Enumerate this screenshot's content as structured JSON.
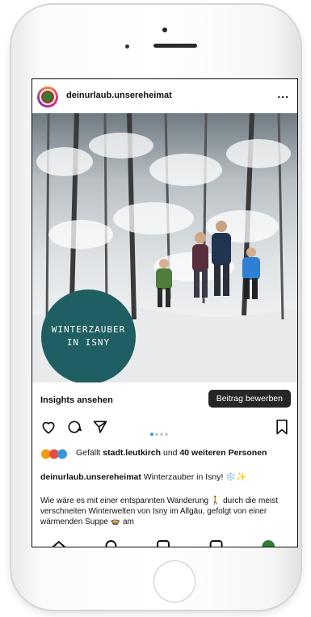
{
  "post": {
    "username": "deinurlaub.unsereheimat",
    "more": "...",
    "badge": {
      "line1": "WINTERZAUBER",
      "line2": "IN ISNY"
    },
    "insights": "Insights ansehen",
    "promote": "Beitrag bewerben",
    "likes": {
      "prefix": "Gefällt",
      "user": "stadt.leutkirch",
      "mid": "und",
      "others": "40 weiteren",
      "suffix": "Personen"
    },
    "caption": {
      "user": "deinurlaub.unsereheimat",
      "text": "Winterzauber in Isny! ❄️✨"
    },
    "body": "Wie wäre es mit einer entspannten Wanderung 🚶 durch die meist verschneiten Winterwelten von Isny im Allgäu, gefolgt von einer wärmenden Suppe 🍲 am"
  },
  "icons": {
    "like": "heart-icon",
    "comment": "comment-icon",
    "share": "send-icon",
    "save": "bookmark-icon"
  },
  "colors": {
    "promote_bg": "#262626",
    "badge_bg": "#1f5e63",
    "carousel_active": "#3897f0"
  }
}
